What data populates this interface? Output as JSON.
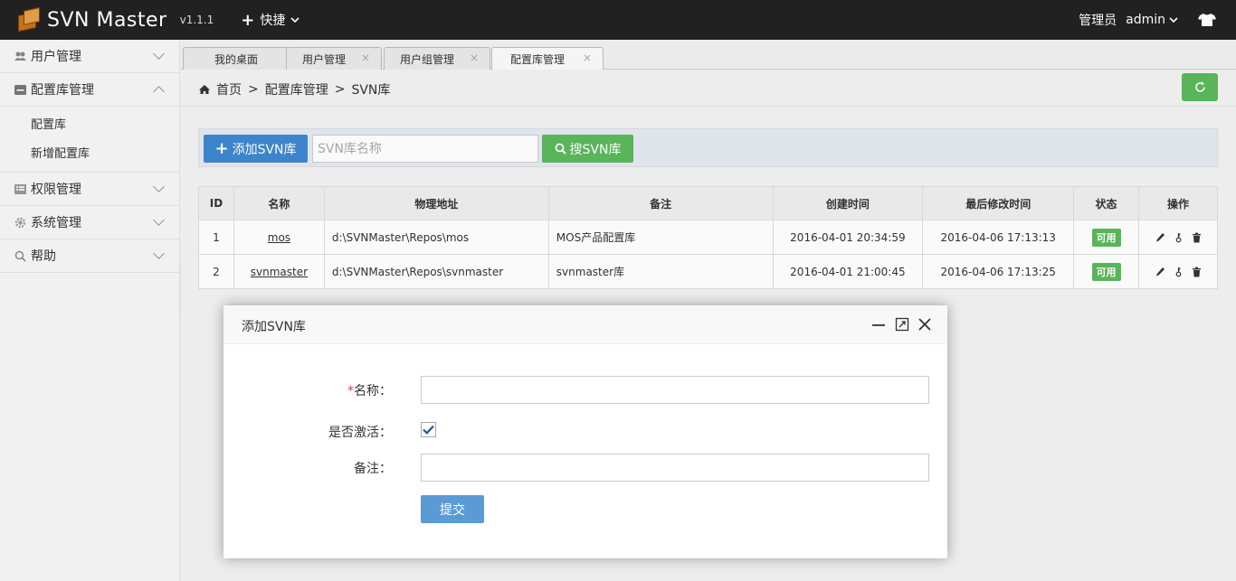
{
  "app": {
    "title": "SVN Master",
    "version": "v1.1.1",
    "quick_label": "快捷",
    "role_label": "管理员",
    "user_name": "admin"
  },
  "sidebar": {
    "items": [
      {
        "label": "用户管理",
        "icon": "users-icon",
        "expanded": false
      },
      {
        "label": "配置库管理",
        "icon": "minus-square-icon",
        "expanded": true,
        "children": [
          "配置库",
          "新增配置库"
        ]
      },
      {
        "label": "权限管理",
        "icon": "list-icon",
        "expanded": false
      },
      {
        "label": "系统管理",
        "icon": "gear-icon",
        "expanded": false
      },
      {
        "label": "帮助",
        "icon": "search-icon",
        "expanded": false
      }
    ]
  },
  "tabs": [
    {
      "label": "我的桌面",
      "closable": false,
      "active": false
    },
    {
      "label": "用户管理",
      "closable": true,
      "active": false
    },
    {
      "label": "用户组管理",
      "closable": true,
      "active": false
    },
    {
      "label": "配置库管理",
      "closable": true,
      "active": true
    }
  ],
  "breadcrumb": [
    "首页",
    "配置库管理",
    "SVN库"
  ],
  "breadcrumb_sep": ">",
  "toolbar": {
    "add_label": "添加SVN库",
    "search_placeholder": "SVN库名称",
    "search_label": "搜SVN库"
  },
  "table": {
    "columns": [
      "ID",
      "名称",
      "物理地址",
      "备注",
      "创建时间",
      "最后修改时间",
      "状态",
      "操作"
    ],
    "rows": [
      {
        "id": "1",
        "name": "mos",
        "path": "d:\\SVNMaster\\Repos\\mos",
        "note": "MOS产品配置库",
        "created": "2016-04-01 20:34:59",
        "modified": "2016-04-06 17:13:13",
        "status": "可用"
      },
      {
        "id": "2",
        "name": "svnmaster",
        "path": "d:\\SVNMaster\\Repos\\svnmaster",
        "note": "svnmaster库",
        "created": "2016-04-01 21:00:45",
        "modified": "2016-04-06 17:13:25",
        "status": "可用"
      }
    ]
  },
  "modal": {
    "title": "添加SVN库",
    "name_label": "名称：",
    "required_mark": "*",
    "active_label": "是否激活：",
    "active_checked": true,
    "note_label": "备注：",
    "submit_label": "提交"
  },
  "colors": {
    "topbar": "#222222",
    "primary": "#3e88cf",
    "success": "#5cb85c",
    "submit": "#5b9bd5"
  }
}
